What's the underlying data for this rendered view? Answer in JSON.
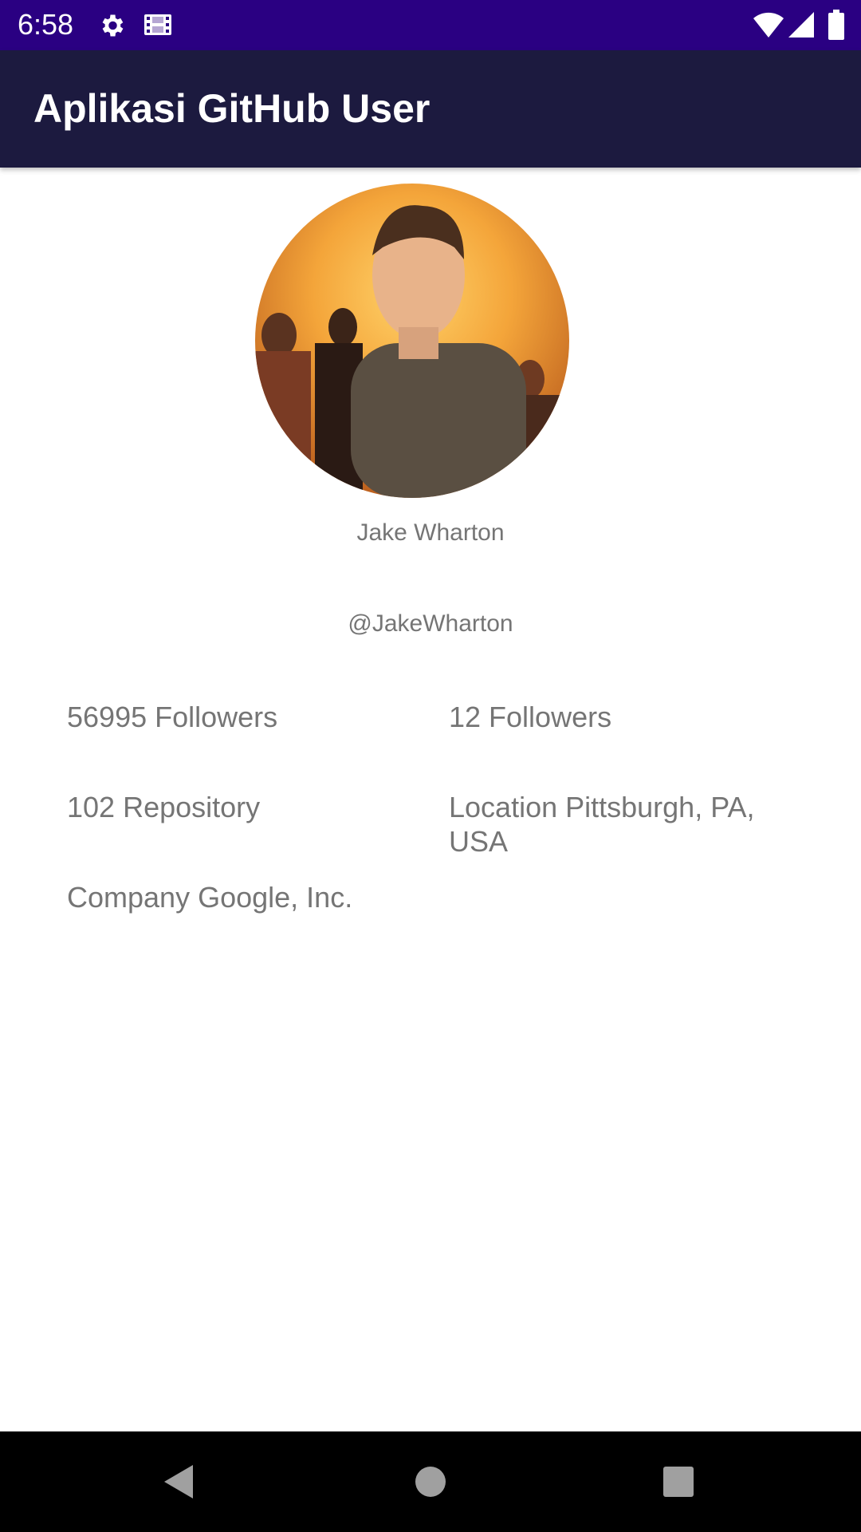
{
  "status_bar": {
    "time": "6:58",
    "icons": [
      "settings-icon",
      "film-icon",
      "wifi-icon",
      "signal-icon",
      "battery-icon"
    ],
    "background": "#2a0082"
  },
  "app_bar": {
    "title": "Aplikasi GitHub User",
    "background": "#1c1a3f"
  },
  "profile": {
    "avatar_icon": "user-avatar-photo",
    "name": "Jake Wharton",
    "username": "@JakeWharton",
    "followers": "56995 Followers",
    "following": "12 Followers",
    "repository": "102 Repository",
    "location": "Location Pittsburgh, PA, USA",
    "company": "Company Google, Inc."
  },
  "nav_bar": {
    "icons": [
      "back-icon",
      "home-icon",
      "recents-icon"
    ],
    "background": "#000000"
  },
  "colors": {
    "text_secondary": "#757575",
    "accent": "#2a0082"
  }
}
